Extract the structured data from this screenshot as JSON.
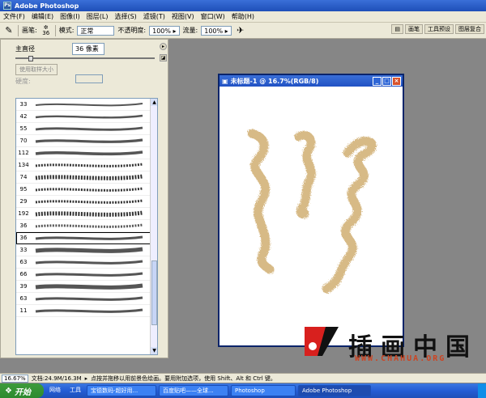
{
  "app": {
    "title": "Adobe Photoshop",
    "icon_label": "Ps"
  },
  "menu": [
    "文件(F)",
    "编辑(E)",
    "图像(I)",
    "图层(L)",
    "选择(S)",
    "滤镜(T)",
    "视图(V)",
    "窗口(W)",
    "帮助(H)"
  ],
  "options": {
    "brush_label": "画笔:",
    "brush_size": "36",
    "mode_label": "模式:",
    "mode_value": "正常",
    "opacity_label": "不透明度:",
    "opacity_value": "100%",
    "flow_label": "流量:",
    "flow_value": "100%",
    "palette_tabs": [
      "画笔",
      "工具预设",
      "图层复合"
    ]
  },
  "brush_panel": {
    "master_diameter_label": "主直径",
    "master_diameter_value": "36 像素",
    "use_sample_size": "使用取样大小",
    "hardness_label": "硬度:",
    "brushes": [
      "33",
      "42",
      "55",
      "70",
      "112",
      "134",
      "74",
      "95",
      "29",
      "192",
      "36",
      "36",
      "33",
      "63",
      "66",
      "39",
      "63",
      "11"
    ]
  },
  "document": {
    "title": "未标题-1 @ 16.7%(RGB/8)",
    "brush_color": "#c9a35e"
  },
  "watermark": {
    "text": "插画中国",
    "url": "WWW.CHAHUA.ORG"
  },
  "status": {
    "zoom": "16.67%",
    "doc_size": "文档:24.9M/16.3M",
    "hint": "点按并拖移以用前景色绘画。要用附加选项，使用 Shift、Alt 和 Ctrl 键。"
  },
  "taskbar": {
    "start": "开始",
    "quick": [
      "网络",
      "工具"
    ],
    "items": [
      "宝德数码-超好用...",
      "百度贴吧——全球...",
      "Photoshop",
      "Adobe Photoshop"
    ]
  }
}
